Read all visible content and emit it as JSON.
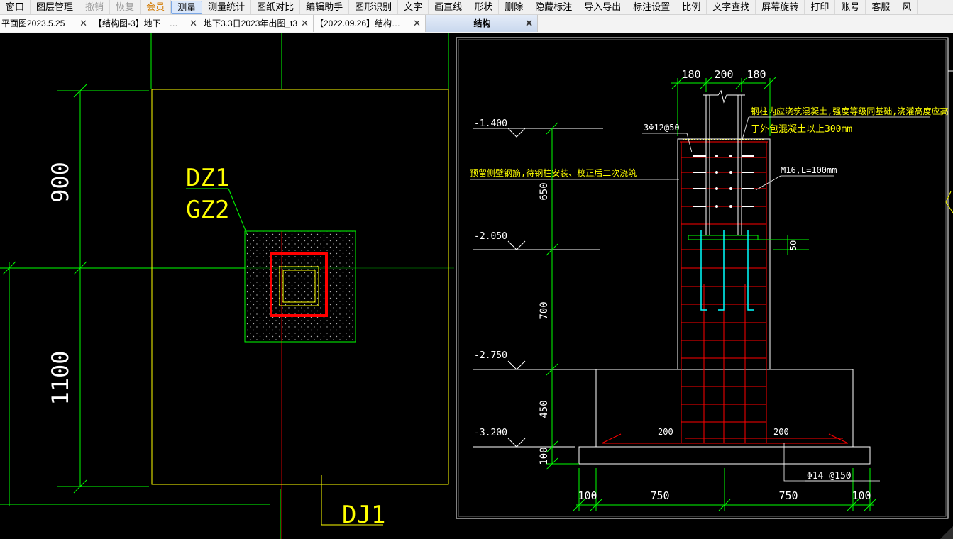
{
  "menu": [
    "窗口",
    "图层管理",
    "撤销",
    "恢复",
    "会员",
    "测量",
    "测量统计",
    "图纸对比",
    "编辑助手",
    "图形识别",
    "文字",
    "画直线",
    "形状",
    "删除",
    "隐藏标注",
    "导入导出",
    "标注设置",
    "比例",
    "文字查找",
    "屏幕旋转",
    "打印",
    "账号",
    "客服",
    "风"
  ],
  "tabs": [
    {
      "label": "平面图2023.5.25",
      "close": "✕"
    },
    {
      "label": "【结构图-3】地下一…",
      "close": "✕"
    },
    {
      "label": "地下3.3日2023年出图_t3",
      "close": "✕"
    },
    {
      "label": "【2022.09.26】结构…",
      "close": "✕"
    },
    {
      "label": "结构",
      "close": "✕"
    }
  ],
  "plan": {
    "dim_top": "900",
    "dim_bottom": "1100",
    "label_dz": "DZ1",
    "label_gz": "GZ2",
    "label_dj": "DJ1"
  },
  "section": {
    "dims_top": [
      "180",
      "200",
      "180"
    ],
    "elevations": [
      "-1.400",
      "-2.050",
      "-2.750",
      "-3.200"
    ],
    "dims_left": [
      "650",
      "700",
      "450",
      "100"
    ],
    "dims_bottom": [
      "100",
      "750",
      "750",
      "100"
    ],
    "dim_50": "50",
    "note_1": "钢柱内应浇筑混凝土,强度等级同基础,浇灌高度应高",
    "note_2": "于外包混凝土以上300mm",
    "note_3": "预留侧壁钢筋,待钢柱安装、校正后二次浇筑",
    "stud_label": "M16,L=100mm",
    "tie_label": "3Φ12@50",
    "base_bar_label": "Φ14 @150",
    "cover_left": "200",
    "cover_right": "200"
  },
  "colors": {
    "background": "#000000",
    "green": "#00ff00",
    "yellow": "#ffff00",
    "red": "#ff0000",
    "white": "#ffffff",
    "cyan": "#00ffff"
  },
  "icons": [
    "close-icon"
  ]
}
